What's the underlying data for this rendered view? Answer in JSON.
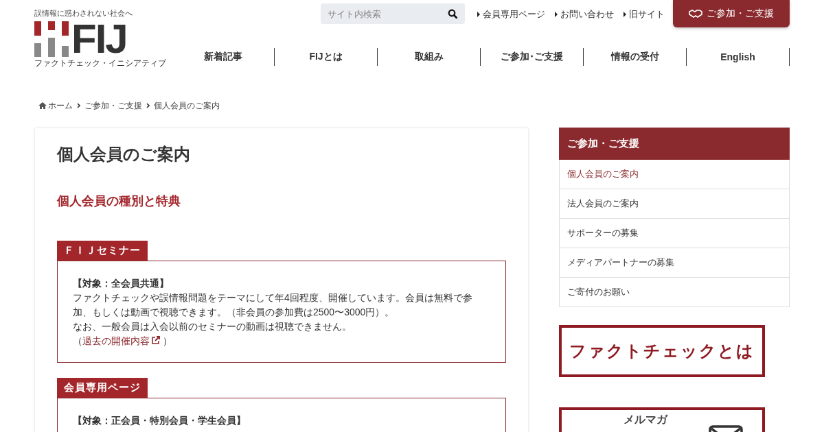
{
  "header": {
    "tagline": "誤情報に惑わされない社会へ",
    "logo_text": "FIJ",
    "logo_subtitle": "ファクトチェック・イニシアティブ",
    "search": {
      "placeholder": "サイト内検索"
    },
    "top_links": [
      "会員専用ページ",
      "お問い合わせ",
      "旧サイト"
    ],
    "cta_button": "ご参加・ご支援",
    "nav": [
      "新着記事",
      "FIJとは",
      "取組み",
      "ご参加･ご支援",
      "情報の受付",
      "English"
    ]
  },
  "breadcrumb": [
    "ホーム",
    "ご参加・ご支援",
    "個人会員のご案内"
  ],
  "article": {
    "title": "個人会員のご案内",
    "subtitle": "個人会員の種別と特典",
    "sections": [
      {
        "label": "ＦＩＪセミナー",
        "target": "【対象：全会員共通】",
        "paragraphs": [
          {
            "kind": "text",
            "text": "ファクトチェックや誤情報問題をテーマにして年4回程度、開催しています。会員は無料で参加、もしくは動画で視聴できます。（非会員の参加費は2500〜3000円）。"
          },
          {
            "kind": "text",
            "text": "なお、一般会員は入会以前のセミナーの動画は視聴できません。"
          },
          {
            "kind": "link",
            "before": "（",
            "link": "過去の開催内容",
            "after": "）"
          }
        ]
      },
      {
        "label": "会員専用ページ",
        "target": "【対象：正会員・特別会員・学生会員】"
      }
    ]
  },
  "sidebar": {
    "heading": "ご参加・ご支援",
    "items": [
      {
        "label": "個人会員のご案内",
        "selected": true
      },
      {
        "label": "法人会員のご案内",
        "selected": false
      },
      {
        "label": "サポーターの募集",
        "selected": false
      },
      {
        "label": "メディアパートナーの募集",
        "selected": false
      },
      {
        "label": "ご寄付のお願い",
        "selected": false
      }
    ],
    "banners": [
      {
        "kind": "factcheck",
        "text": "ファクトチェックとは"
      },
      {
        "kind": "newsletter",
        "text": "メルマガ"
      }
    ]
  }
}
